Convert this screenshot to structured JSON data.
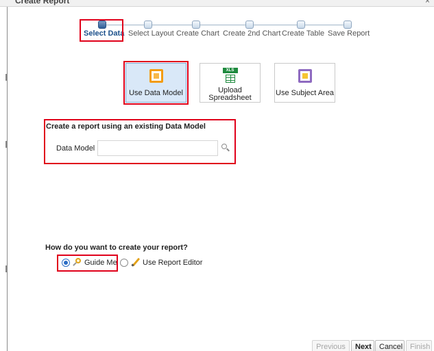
{
  "dialog": {
    "title": "Create Report",
    "close_glyph": "×"
  },
  "train": {
    "steps": [
      {
        "label": "Select Data",
        "current": true
      },
      {
        "label": "Select Layout",
        "current": false
      },
      {
        "label": "Create Chart",
        "current": false
      },
      {
        "label": "Create 2nd Chart",
        "current": false
      },
      {
        "label": "Create Table",
        "current": false
      },
      {
        "label": "Save Report",
        "current": false
      }
    ]
  },
  "sources": {
    "use_data_model": "Use Data Model",
    "upload_spreadsheet_line1": "Upload",
    "upload_spreadsheet_line2": "Spreadsheet",
    "xls_tag": "XLS",
    "use_subject_area": "Use Subject Area",
    "selected": "use_data_model"
  },
  "data_model_section": {
    "title": "Create a report using an existing Data Model",
    "label": "Data Model",
    "value": "",
    "placeholder": ""
  },
  "creation_mode": {
    "question": "How do you want to create your report?",
    "options": [
      {
        "label": "Guide Me",
        "checked": true,
        "icon": "guide-me-icon"
      },
      {
        "label": "Use Report Editor",
        "checked": false,
        "icon": "pencil-icon"
      }
    ]
  },
  "footer": {
    "previous": "Previous",
    "next": "Next",
    "cancel": "Cancel",
    "finish": "Finish"
  },
  "colors": {
    "highlight": "#e0001a",
    "selected_tile": "#d9e8f8",
    "train_current": "#2f5f98"
  }
}
